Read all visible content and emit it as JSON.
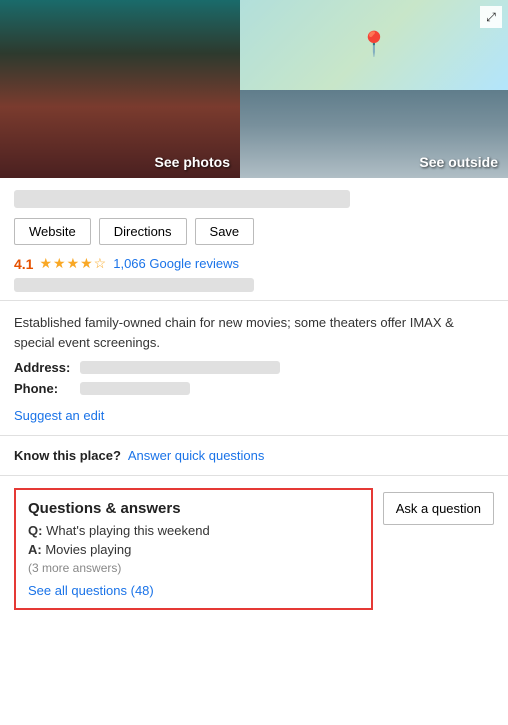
{
  "photos": {
    "see_photos_label": "See photos",
    "see_outside_label": "See outside",
    "expand_icon": "⤢"
  },
  "actions": {
    "website_label": "Website",
    "directions_label": "Directions",
    "save_label": "Save"
  },
  "rating": {
    "value": "4.1",
    "stars": "★★★★☆",
    "reviews_text": "1,066 Google reviews"
  },
  "description": {
    "text": "Established family-owned chain for new movies; some theaters offer IMAX & special event screenings.",
    "address_label": "Address:",
    "phone_label": "Phone:",
    "suggest_edit_label": "Suggest an edit"
  },
  "know": {
    "label": "Know this place?",
    "link_label": "Answer quick questions"
  },
  "qa": {
    "title": "Questions & answers",
    "question_label": "Q:",
    "question_text": "What's playing this weekend",
    "answer_label": "A:",
    "answer_text": "Movies playing",
    "more_answers": "(3 more answers)",
    "see_all_label": "See all questions (48)",
    "ask_button_label": "Ask a question"
  }
}
